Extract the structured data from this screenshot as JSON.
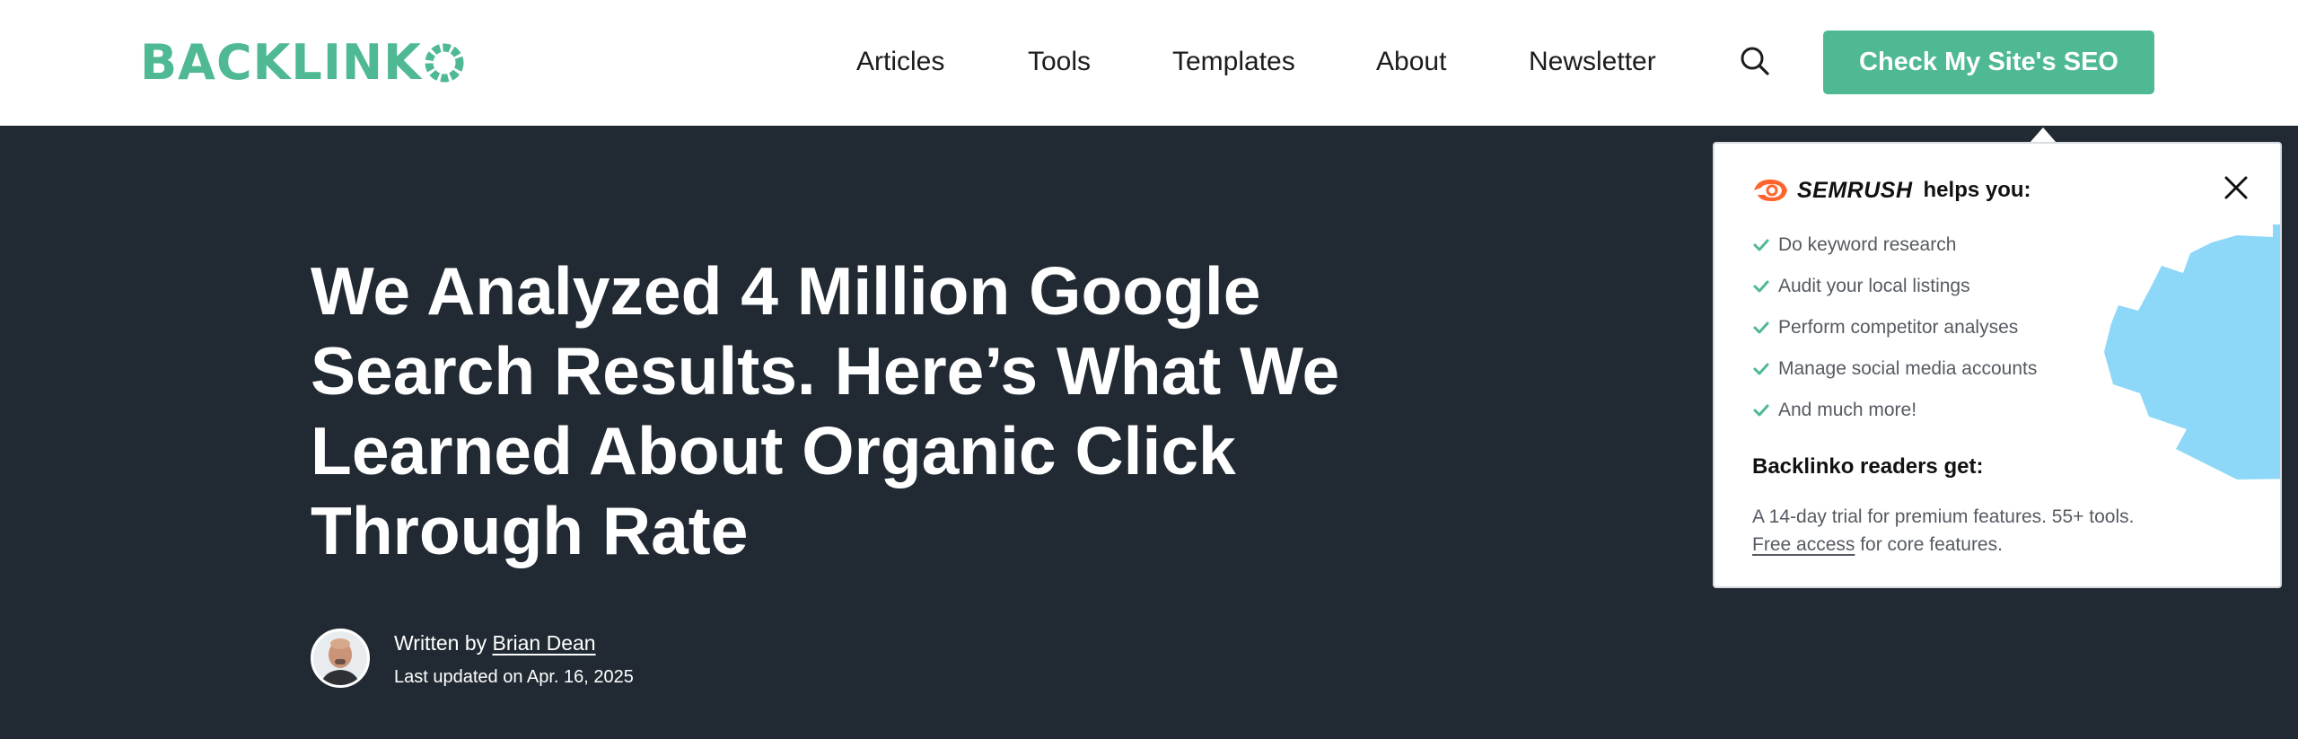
{
  "header": {
    "logo": {
      "text": "BACKLINK",
      "last_letter_icon": "o-circle-icon"
    },
    "nav": [
      {
        "label": "Articles"
      },
      {
        "label": "Tools"
      },
      {
        "label": "Templates"
      },
      {
        "label": "About"
      },
      {
        "label": "Newsletter"
      }
    ],
    "search_icon": "search-icon",
    "cta_label": "Check My Site's SEO"
  },
  "hero": {
    "title": "We Analyzed 4 Million Google Search Results. Here’s What We Learned About Organic Click Through Rate",
    "author": {
      "prefix": "Written by ",
      "name": "Brian Dean",
      "updated": "Last updated on Apr. 16, 2025"
    }
  },
  "popup": {
    "brand": "SEMRUSH",
    "brand_icon": "semrush-flame-icon",
    "helps_text": "helps you:",
    "close_icon": "close-icon",
    "benefits": [
      "Do keyword research",
      "Audit your local listings",
      "Perform competitor analyses",
      "Manage social media accounts",
      "And much more!"
    ],
    "readers_heading": "Backlinko readers get:",
    "readers_line": "A 14-day trial for premium features. 55+ tools.",
    "free_access_link": "Free access",
    "readers_tail": " for core features."
  },
  "colors": {
    "brand_green": "#4fb993",
    "hero_bg": "#212a33",
    "semrush_orange": "#ff642d",
    "blob_blue": "#8dd8f8"
  }
}
